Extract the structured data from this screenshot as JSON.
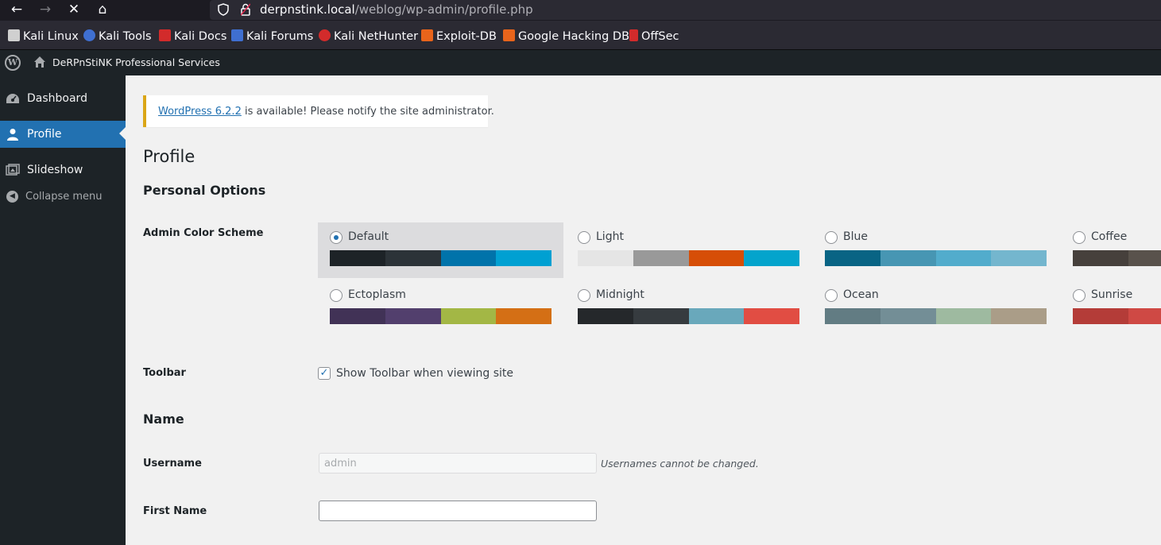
{
  "browser": {
    "url_host": "derpnstink.local",
    "url_path": "/weblog/wp-admin/profile.php",
    "bookmarks": [
      {
        "label": "Kali Linux",
        "icon": "kali-dragon-icon",
        "color": "#d0d0d0"
      },
      {
        "label": "Kali Tools",
        "icon": "kali-tools-icon",
        "color": "#3f6fd1"
      },
      {
        "label": "Kali Docs",
        "icon": "kali-docs-icon",
        "color": "#d22b2b"
      },
      {
        "label": "Kali Forums",
        "icon": "kali-forums-icon",
        "color": "#3f6fd1"
      },
      {
        "label": "Kali NetHunter",
        "icon": "nethunter-icon",
        "color": "#d22b2b"
      },
      {
        "label": "Exploit-DB",
        "icon": "exploit-db-icon",
        "color": "#e8641b"
      },
      {
        "label": "Google Hacking DB",
        "icon": "ghdb-icon",
        "color": "#e8641b"
      },
      {
        "label": "OffSec",
        "icon": "offsec-icon",
        "color": "#d22b2b"
      }
    ]
  },
  "adminbar": {
    "site_name": "DeRPnStiNK Professional Services"
  },
  "sidebar": {
    "items": [
      {
        "label": "Dashboard",
        "icon": "dashboard-icon"
      },
      {
        "label": "Profile",
        "icon": "user-icon",
        "current": true
      },
      {
        "label": "Slideshow",
        "icon": "slideshow-icon"
      }
    ],
    "collapse_label": "Collapse menu"
  },
  "notice": {
    "link_text": "WordPress 6.2.2",
    "text": " is available! Please notify the site administrator."
  },
  "page": {
    "title": "Profile",
    "personal_options": "Personal Options",
    "color_scheme_label": "Admin Color Scheme",
    "schemes": [
      {
        "name": "Default",
        "selected": true,
        "colors": [
          "#1d2327",
          "#2c3338",
          "#2271b1",
          "#72aee6"
        ]
      },
      {
        "name": "Light",
        "selected": false,
        "colors": [
          "#e5e5e5",
          "#999999",
          "#d64e07",
          "#04a4cc"
        ]
      },
      {
        "name": "Blue",
        "selected": false,
        "colors": [
          "#096484",
          "#4796b3",
          "#52accc",
          "#74b6ce"
        ]
      },
      {
        "name": "Coffee",
        "selected": false,
        "colors": [
          "#46403c",
          "#59524c",
          "#c7a589",
          "#9ea476"
        ]
      },
      {
        "name": "Ectoplasm",
        "selected": false,
        "colors": [
          "#413256",
          "#523f6d",
          "#a3b745",
          "#d46f15"
        ]
      },
      {
        "name": "Midnight",
        "selected": false,
        "colors": [
          "#25282b",
          "#363b3f",
          "#69a8bb",
          "#e14d43"
        ]
      },
      {
        "name": "Ocean",
        "selected": false,
        "colors": [
          "#627c83",
          "#738e96",
          "#9ebaa0",
          "#aa9d88"
        ]
      },
      {
        "name": "Sunrise",
        "selected": false,
        "colors": [
          "#b43c38",
          "#cf4944",
          "#dd823b",
          "#ccaf0b"
        ]
      }
    ],
    "toolbar_label": "Toolbar",
    "toolbar_checkbox_label": "Show Toolbar when viewing site",
    "toolbar_checked": true,
    "name_section": "Name",
    "username_label": "Username",
    "username_value": "admin",
    "username_note": "Usernames cannot be changed.",
    "first_name_label": "First Name",
    "first_name_value": ""
  }
}
